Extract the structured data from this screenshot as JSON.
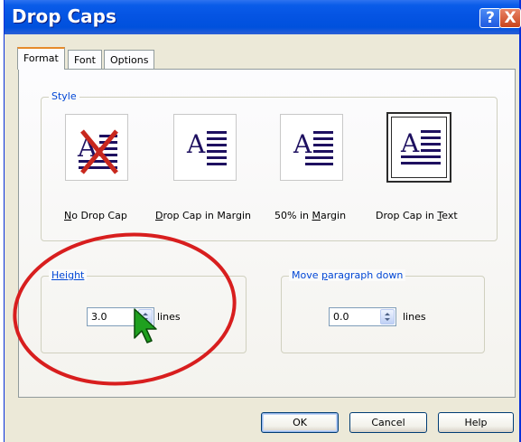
{
  "window": {
    "title": "Drop Caps",
    "help_glyph": "?",
    "close_glyph": "X"
  },
  "tabs": [
    {
      "label": "Format",
      "active": true
    },
    {
      "label": "Font",
      "active": false
    },
    {
      "label": "Options",
      "active": false
    }
  ],
  "style_group": {
    "label": "Style",
    "options": [
      {
        "label": "No Drop Cap",
        "mnemonic": "N",
        "rest": "o Drop Cap",
        "selected": false,
        "icon": "no-drop-cap-icon"
      },
      {
        "label": "Drop Cap in Margin",
        "mnemonic": "D",
        "rest": "rop Cap in Margin",
        "selected": false,
        "icon": "drop-cap-margin-icon"
      },
      {
        "label": "50% in Margin",
        "pre": "50% in ",
        "mnemonic": "M",
        "rest": "argin",
        "selected": false,
        "icon": "half-margin-icon"
      },
      {
        "label": "Drop Cap in Text",
        "pre": "Drop Cap in ",
        "mnemonic": "T",
        "rest": "ext",
        "selected": true,
        "icon": "drop-cap-text-icon"
      }
    ],
    "icon_letter": "A"
  },
  "height_group": {
    "label": "Height",
    "value": "3.0",
    "unit": "lines"
  },
  "move_group": {
    "label_pre": "Move ",
    "label_mnemonic": "p",
    "label_rest": "aragraph down",
    "label": "Move paragraph down",
    "value": "0.0",
    "unit": "lines"
  },
  "buttons": {
    "ok": "OK",
    "cancel": "Cancel",
    "help": "Help"
  },
  "colors": {
    "titlebar": "#0054E3",
    "group_label": "#0046D5",
    "annotation_ellipse": "#D81E1E",
    "cursor": "#1FA01F",
    "icon_lines": "#1E1060"
  }
}
